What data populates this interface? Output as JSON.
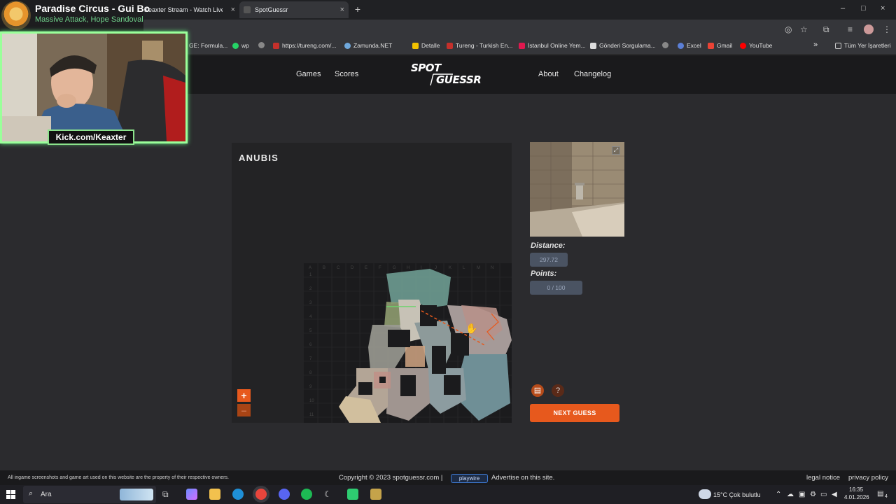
{
  "browser": {
    "tabs": [
      {
        "label": "Keaxter Stream - Watch Live on"
      },
      {
        "label": "SpotGuessr"
      }
    ],
    "new_tab": "+",
    "window_controls": [
      "–",
      "□",
      "×"
    ],
    "bookmarks": [
      "GE: Formula...",
      "wp",
      "https://tureng.com/...",
      "Zamunda.NET",
      "Detalle",
      "Tureng - Turkish En...",
      "İstanbul Online Yem...",
      "Gönderi Sorgulama...",
      "Excel",
      "Gmail",
      "YouTube"
    ],
    "bookmarks_overflow": "»",
    "all_bookmarks": "Tüm Yer İşaretleri"
  },
  "site": {
    "nav": {
      "games": "Games",
      "scores": "Scores",
      "about": "About",
      "changelog": "Changelog"
    },
    "logo": {
      "line1": "SPOT",
      "line2": "GUESSR"
    },
    "map": {
      "title": "ANUBIS",
      "zoom_in": "+",
      "zoom_out": "–",
      "grid_cols": [
        "A",
        "B",
        "C",
        "D",
        "E",
        "F",
        "G",
        "H",
        "I",
        "J",
        "K",
        "L",
        "M",
        "N"
      ],
      "grid_rows": [
        "1",
        "2",
        "3",
        "4",
        "5",
        "6",
        "7",
        "8",
        "9",
        "10",
        "11"
      ]
    },
    "result": {
      "distance_label": "Distance:",
      "distance_value": "297.72",
      "points_label": "Points:",
      "points_value": "0 / 100",
      "help_label": "?",
      "next_button": "NEXT GUESS"
    },
    "footer": {
      "disclaimer": "All ingame screenshots and game art used on this website are the property of their respective owners.",
      "copyright": "Copyright © 2023 spotguessr.com  |",
      "playwire": "playwire",
      "advertise": "Advertise on this site.",
      "legal": "legal notice",
      "privacy": "privacy policy"
    }
  },
  "stream": {
    "now_playing_title": "Paradise Circus - Gui Bo",
    "now_playing_artist": "Massive Attack, Hope Sandoval",
    "kick_handle": "Kick.com/Keaxter"
  },
  "taskbar": {
    "search_placeholder": "Ara",
    "weather": "15°C  Çok bulutlu",
    "time": "16:35",
    "date": "4.01.2026",
    "notifications": "4"
  },
  "colors": {
    "accent_orange": "#e7591d",
    "header_bg": "#1a1a1c",
    "body_bg": "#2b2b2e",
    "stat_box": "#4a5362",
    "cam_border": "#9aff9a"
  }
}
